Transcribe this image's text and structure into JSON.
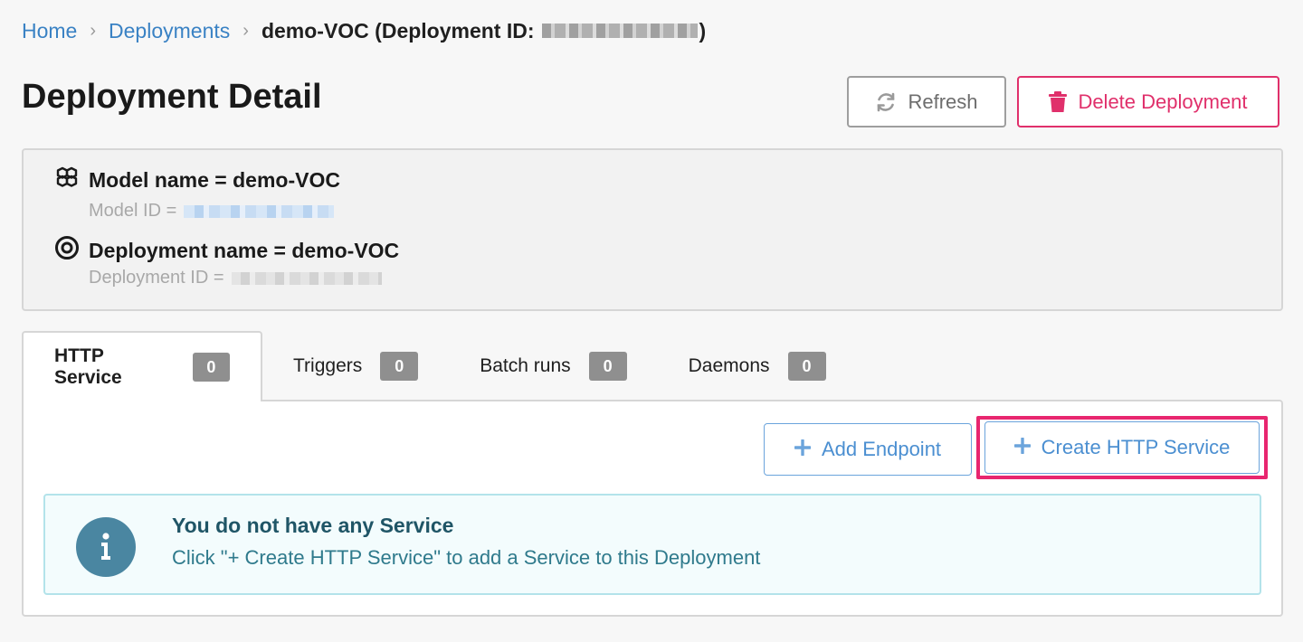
{
  "breadcrumb": {
    "home": "Home",
    "deployments": "Deployments",
    "current_prefix": "demo-VOC (Deployment ID:",
    "current_suffix": ")"
  },
  "page": {
    "title": "Deployment Detail"
  },
  "actions": {
    "refresh_label": "Refresh",
    "delete_label": "Delete Deployment"
  },
  "info": {
    "model_name": "Model name = demo-VOC",
    "model_id_label": "Model ID =",
    "deployment_name": "Deployment name = demo-VOC",
    "deployment_id_label": "Deployment ID ="
  },
  "tabs": [
    {
      "label": "HTTP Service",
      "count": "0",
      "active": true
    },
    {
      "label": "Triggers",
      "count": "0",
      "active": false
    },
    {
      "label": "Batch runs",
      "count": "0",
      "active": false
    },
    {
      "label": "Daemons",
      "count": "0",
      "active": false
    }
  ],
  "panel": {
    "add_endpoint_label": "Add Endpoint",
    "create_http_label": "Create HTTP Service"
  },
  "alert": {
    "title": "You do not have any Service",
    "text": "Click \"+ Create HTTP Service\" to add a Service to this Deployment"
  },
  "colors": {
    "link": "#3a82c4",
    "danger": "#e0306b",
    "primary_outline": "#4b8fd1",
    "highlight": "#e8266f",
    "alert_icon": "#4a86a1"
  },
  "icons": {
    "refresh": "refresh-icon",
    "delete": "trash-icon",
    "model": "cubes-icon",
    "deployment": "target-icon",
    "plus": "plus-icon",
    "info": "info-icon"
  }
}
